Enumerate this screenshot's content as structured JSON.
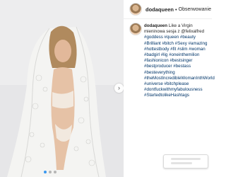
{
  "post": {
    "username": "dodaqueen",
    "separator": "•",
    "follow_label": "Obserwowanie",
    "caption": {
      "username": "dodaqueen",
      "line1": "Like a Virgin",
      "line2": "mieninowa sesja z @felixalfred",
      "hashtags": [
        "#goddess #queen #beauty",
        "#Brilliant #bitch #Sexy #amazing",
        "#hottestbody #fit #slim #woman",
        "#badgirl #lig #oneinthemilion",
        "#fashionicon #bestsinger",
        "#bestproducer #bestass",
        "#besteverything",
        "#theMostIncredibleWomanInthWorld",
        "#universe #bitchplease",
        "#dontfuckwithmyfabulousness",
        "#StartedtolikeHashtags"
      ]
    },
    "carousel_arrow": "›"
  },
  "colors": {
    "hashtag": "#003569",
    "carousel_active": "#3897f0"
  }
}
